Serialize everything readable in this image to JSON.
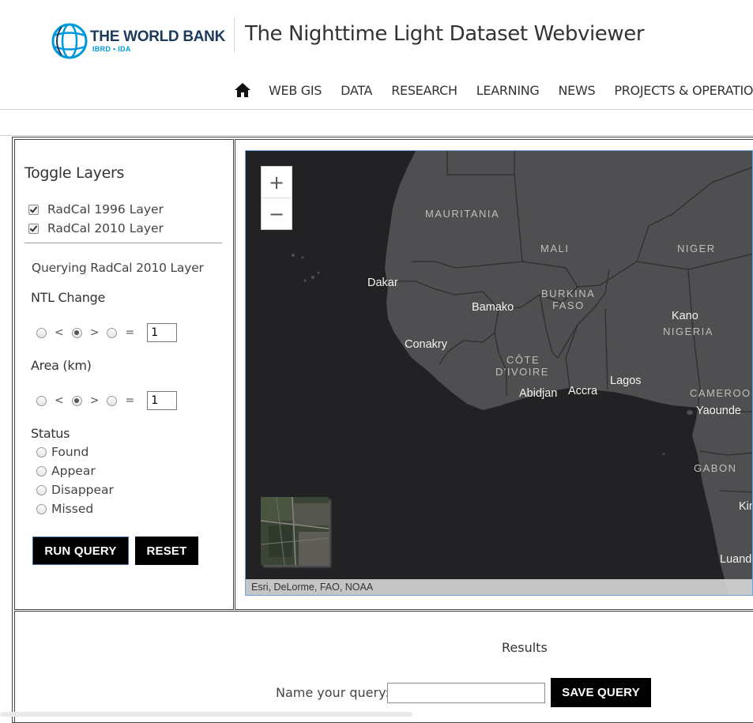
{
  "header": {
    "logo": {
      "name": "THE WORLD BANK",
      "sub": "IBRD • IDA",
      "icon": "globe-icon"
    },
    "site_title": "The Nighttime Light Dataset Webviewer",
    "nav": {
      "home_icon": "home-icon",
      "items": [
        "WEB GIS",
        "DATA",
        "RESEARCH",
        "LEARNING",
        "NEWS",
        "PROJECTS & OPERATIONS"
      ]
    }
  },
  "sidebar": {
    "title": "Toggle Layers",
    "layers": [
      {
        "label": "RadCal 1996 Layer",
        "checked": true
      },
      {
        "label": "RadCal 2010 Layer",
        "checked": true
      }
    ],
    "query_label": "Querying RadCal 2010 Layer",
    "ntl_change": {
      "label": "NTL Change",
      "operators": [
        "<",
        ">",
        "="
      ],
      "selected": ">",
      "value": "1"
    },
    "area": {
      "label": "Area (km)",
      "operators": [
        "<",
        ">",
        "="
      ],
      "selected": ">",
      "value": "1"
    },
    "status": {
      "label": "Status",
      "options": [
        "Found",
        "Appear",
        "Disappear",
        "Missed"
      ]
    },
    "run_label": "RUN QUERY",
    "reset_label": "RESET"
  },
  "map": {
    "zoom_in": "+",
    "zoom_out": "−",
    "attribution": "Esri, DeLorme, FAO, NOAA",
    "labels": {
      "mauritania": "MAURITANIA",
      "mali": "MALI",
      "niger": "NIGER",
      "dakar": "Dakar",
      "bamako": "Bamako",
      "burkina1": "BURKINA",
      "burkina2": "FASO",
      "kano": "Kano",
      "nigeria": "NIGERIA",
      "conakry": "Conakry",
      "cote1": "CÔTE",
      "cote2": "D'IVOIRE",
      "abidjan": "Abidjan",
      "accra": "Accra",
      "lagos": "Lagos",
      "cameroon": "CAMEROO",
      "yaounde": "Yaounde",
      "gabon": "GABON",
      "kin": "Kin",
      "luanda": "Luand"
    },
    "colors": {
      "land": "#505052",
      "water": "#222225",
      "border": "#2b2b2d"
    }
  },
  "results": {
    "title": "Results",
    "name_label": "Name your query:",
    "name_value": "",
    "save_label": "SAVE QUERY"
  }
}
